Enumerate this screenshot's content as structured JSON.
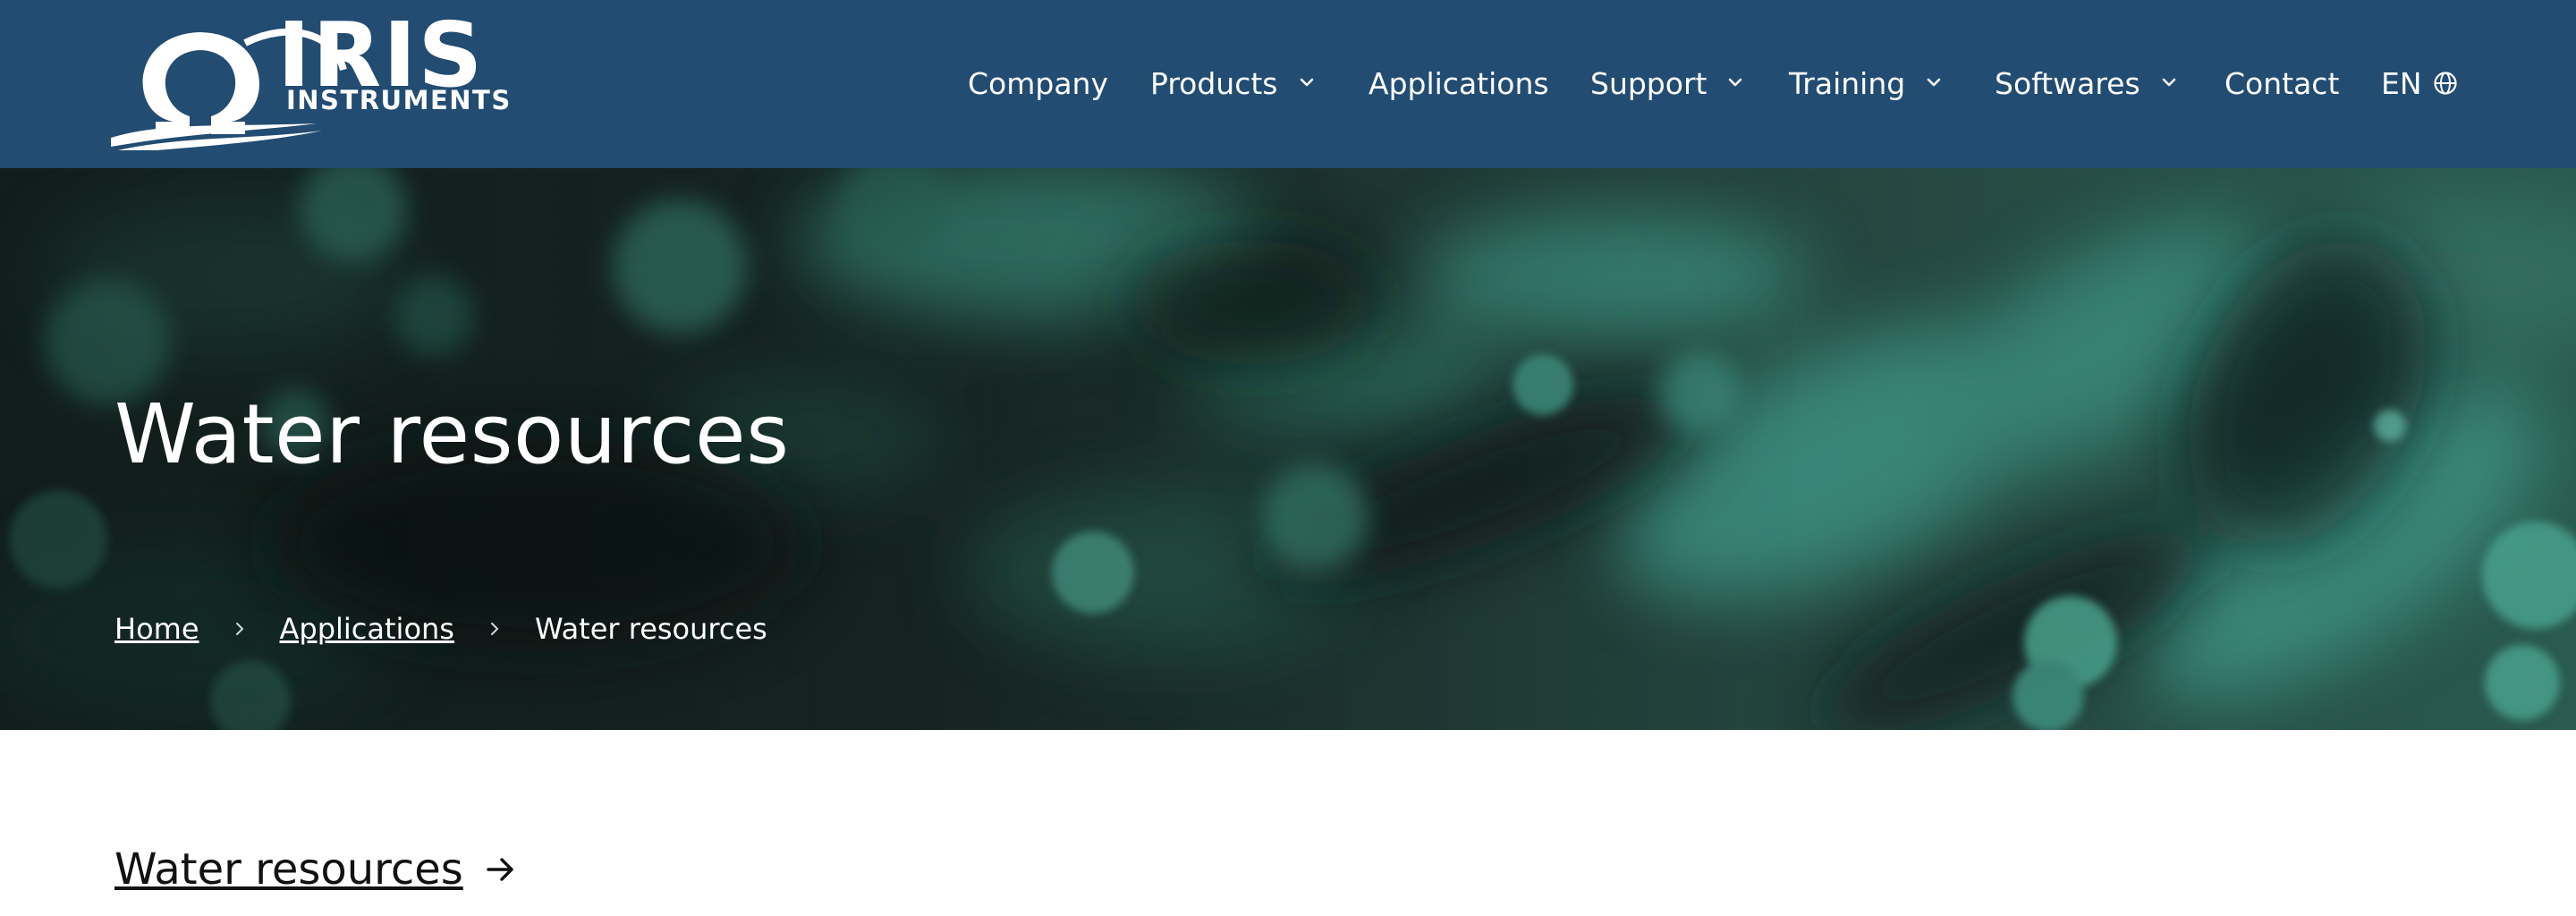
{
  "logo": {
    "name": "IRIS",
    "tagline": "INSTRUMENTS"
  },
  "nav": {
    "items": [
      {
        "label": "Company",
        "has_dropdown": false
      },
      {
        "label": "Products",
        "has_dropdown": true
      },
      {
        "label": "Applications",
        "has_dropdown": false
      },
      {
        "label": "Support",
        "has_dropdown": true
      },
      {
        "label": "Training",
        "has_dropdown": true
      },
      {
        "label": "Softwares",
        "has_dropdown": true
      },
      {
        "label": "Contact",
        "has_dropdown": false
      }
    ],
    "language": "EN",
    "language_icon": "globe-icon",
    "dropdown_icon": "chevron-down-icon"
  },
  "hero": {
    "title": "Water resources",
    "breadcrumb": [
      "Home",
      "Applications",
      "Water resources"
    ],
    "separator_icon": "chevron-right-icon"
  },
  "content": {
    "section_title": "Water resources",
    "section_icon": "arrow-right-icon"
  },
  "colors": {
    "header_bg": "#224c72",
    "hero_teal": "#3a8a7a",
    "text_dark": "#111111",
    "text_light": "#ffffff"
  }
}
